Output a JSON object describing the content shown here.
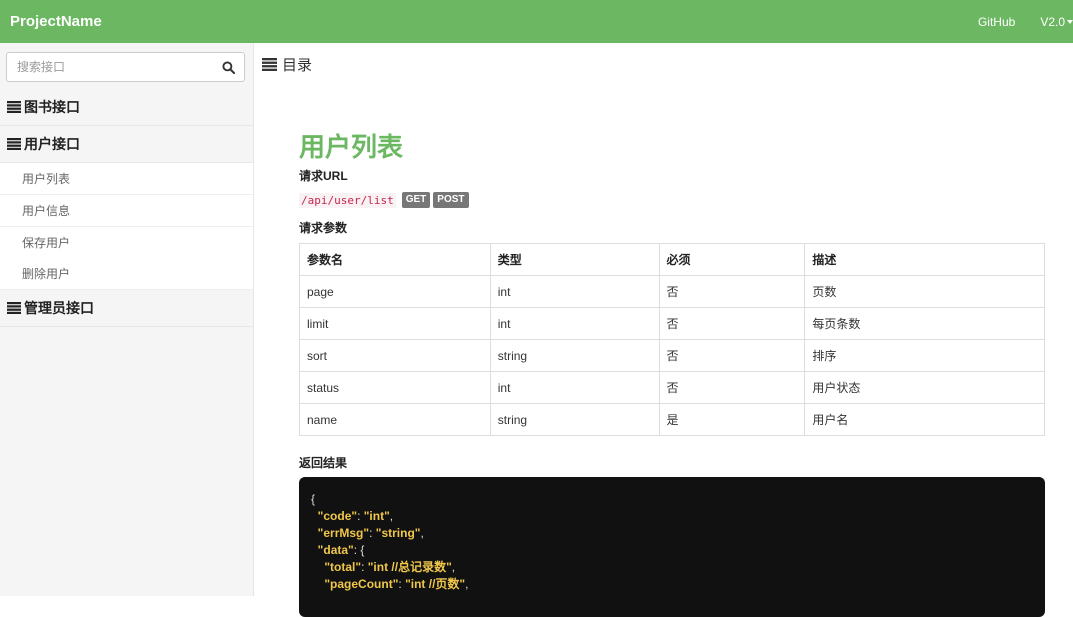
{
  "navbar": {
    "brand": "ProjectName",
    "github": "GitHub",
    "version": "V2.0"
  },
  "sidebar": {
    "search_placeholder": "搜索接口",
    "groups": [
      {
        "label": "图书接口"
      },
      {
        "label": "用户接口",
        "items": [
          "用户列表",
          "用户信息",
          "保存用户",
          "删除用户"
        ]
      },
      {
        "label": "管理员接口"
      }
    ]
  },
  "main": {
    "toc": "目录",
    "title": "用户列表",
    "request_url_label": "请求URL",
    "url": "/api/user/list",
    "methods": [
      "GET",
      "POST"
    ],
    "params_label": "请求参数",
    "table": {
      "headers": [
        "参数名",
        "类型",
        "必须",
        "描述"
      ],
      "rows": [
        [
          "page",
          "int",
          "否",
          "页数"
        ],
        [
          "limit",
          "int",
          "否",
          "每页条数"
        ],
        [
          "sort",
          "string",
          "否",
          "排序"
        ],
        [
          "status",
          "int",
          "否",
          "用户状态"
        ],
        [
          "name",
          "string",
          "是",
          "用户名"
        ]
      ]
    },
    "result_label": "返回结果",
    "code": {
      "open": "{",
      "code_key": "\"code\"",
      "code_val": "\"int\"",
      "errmsg_key": "\"errMsg\"",
      "errmsg_val": "\"string\"",
      "data_key": "\"data\"",
      "total_key": "\"total\"",
      "total_val": "\"int //总记录数\"",
      "pagecount_key": "\"pageCount\"",
      "pagecount_val": "\"int //页数\""
    }
  },
  "colors": {
    "brand_green": "#6cb862",
    "code_bg": "#111111",
    "code_key": "#f0c74a",
    "url_red": "#c7254e"
  }
}
